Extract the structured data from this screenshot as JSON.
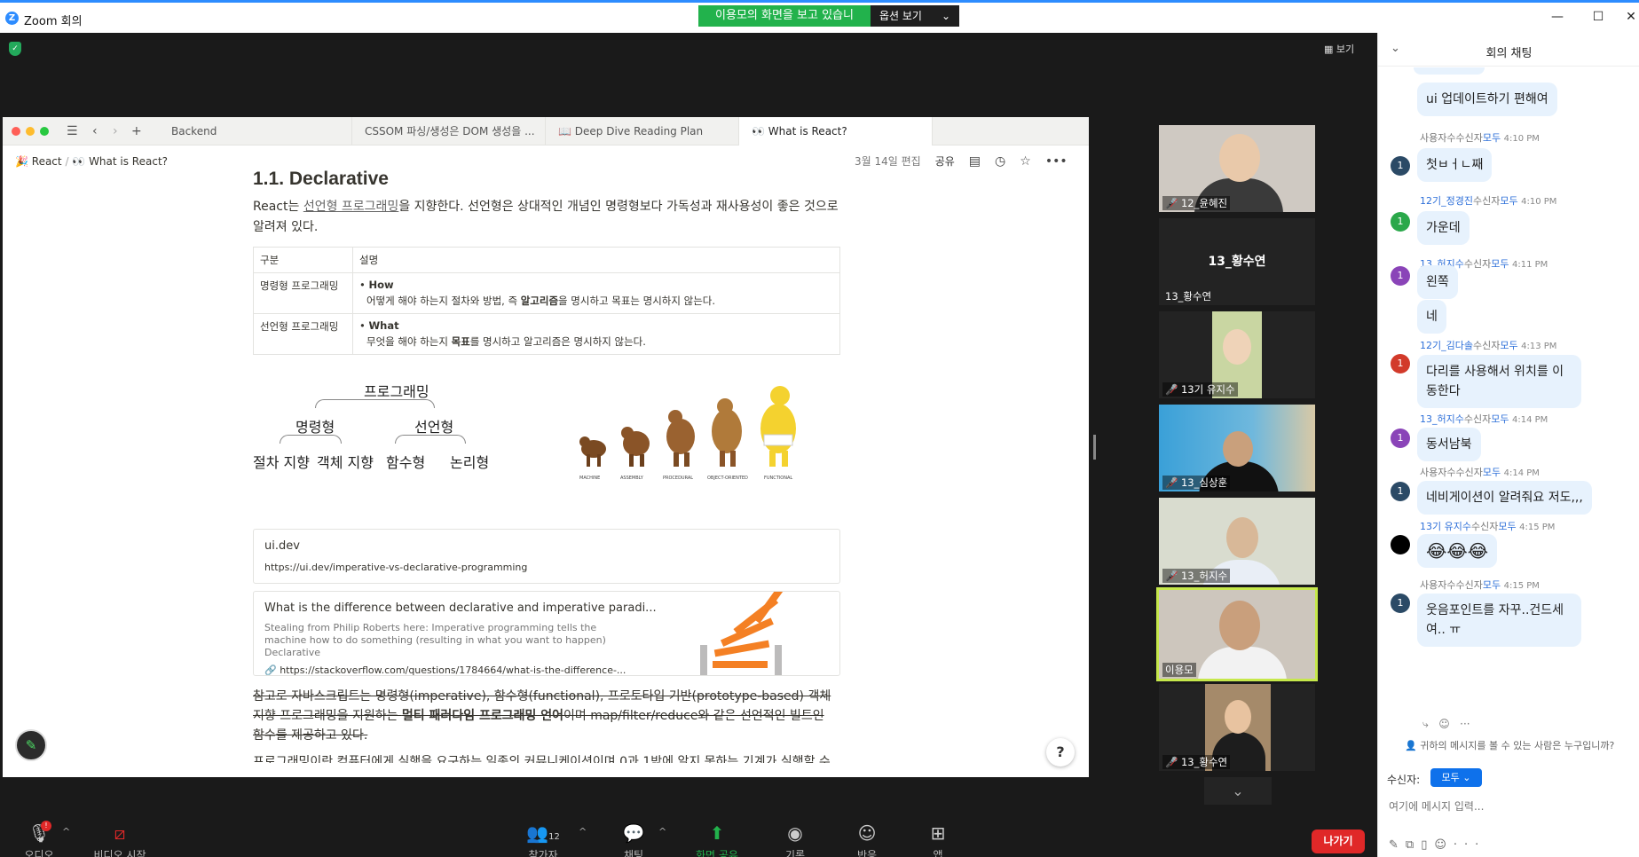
{
  "window": {
    "title": "Zoom 회의",
    "min": "—",
    "max": "☐",
    "close": "✕",
    "logo": "Z"
  },
  "share_banner": {
    "text": "이용모의 화면을 보고 있습니다",
    "options": "옵션 보기"
  },
  "view_label": "보기",
  "notion": {
    "tabs": [
      "Backend",
      "CSSOM 파싱/생성은 DOM 생성을 ...",
      "Deep Dive Reading Plan",
      "What is React?"
    ],
    "breadcrumb": {
      "parent": "React",
      "current": "What is React?"
    },
    "edited": "3월 14일 편집",
    "share": "공유",
    "heading": "1.1. Declarative",
    "intro_pre": "React는 ",
    "intro_link": "선언형 프로그래밍",
    "intro_post": "을 지향한다. 선언형은 상대적인 개념인 명령형보다 가독성과 재사용성이 좋은 것으로 알려져 있다.",
    "table": {
      "headers": [
        "구분",
        "설명"
      ],
      "rows": [
        {
          "label": "명령형 프로그래밍",
          "bullet": "How",
          "desc_pre": "어떻게 해야 하는지 절차와 방법, 즉 ",
          "desc_bold": "알고리즘",
          "desc_post": "을 명시하고 목표는 명시하지 않는다."
        },
        {
          "label": "선언형 프로그래밍",
          "bullet": "What",
          "desc_pre": "무엇을 해야 하는지 ",
          "desc_bold": "목표",
          "desc_post": "를 명시하고 알고리즘은 명시하지 않는다."
        }
      ]
    },
    "diagram": {
      "root": "프로그래밍",
      "left": "명령형",
      "right": "선언형",
      "leaves": [
        "절차 지향",
        "객체 지향",
        "함수형",
        "논리형"
      ],
      "evolution": [
        "MACHINE",
        "ASSEMBLY",
        "PROCEDURAL",
        "OBJECT-ORIENTED",
        "FUNCTIONAL"
      ]
    },
    "bookmark1": {
      "title": "ui.dev",
      "url": "https://ui.dev/imperative-vs-declarative-programming"
    },
    "bookmark2": {
      "title": "What is the difference between declarative and imperative paradi...",
      "desc": "Stealing from Philip Roberts here: Imperative programming tells the machine how to do something (resulting in what you want to happen) Declarative",
      "url": "https://stackoverflow.com/questions/1784664/what-is-the-difference-..."
    },
    "strike_1": "참고로 자바스크립트는 명령형(imperative), 함수형(functional), 프로토타입 기반(prototype-based) 객체지향 프로그래밍을 지원하는 ",
    "strike_bold": "멀티 패러다임 프로그래밍 언어",
    "strike_2": "이며 map/filter/reduce와 같은 선언적인 빌트인 함수를 제공하고 있다.",
    "cutoff": "프로그래밍이란 컴퓨터에게 실행을 요구하는 일종의 커뮤니케이션이며 0과 1밖에 알지 못하는 기계가 실행할 수",
    "help": "?"
  },
  "participants": [
    {
      "name": "12_윤혜진",
      "muted": true
    },
    {
      "name": "13_황수연",
      "muted": false,
      "big": "13_황수연"
    },
    {
      "name": "13기 유지수",
      "muted": true
    },
    {
      "name": "13_심상훈",
      "muted": true
    },
    {
      "name": "13_허지수",
      "muted": true
    },
    {
      "name": "이용모",
      "muted": false,
      "active": true
    },
    {
      "name": "13_황수연",
      "muted": true
    }
  ],
  "toolbar": {
    "audio": "오디오",
    "video": "비디오 시작",
    "participants": "참가자",
    "participants_count": "12",
    "chat": "채팅",
    "share": "화면 공유",
    "record": "기록",
    "reactions": "반응",
    "apps": "앱",
    "leave": "나가기",
    "audio_badge": "!"
  },
  "chat": {
    "title": "회의 채팅",
    "messages": [
      {
        "sender": "",
        "text": "ui 업데이트하기 편해여",
        "avatar": "",
        "color": ""
      },
      {
        "sender": "사용자수",
        "to": "모두",
        "time": "4:10 PM",
        "text": "첫ㅂㅓㄴ째",
        "avatar": "1",
        "color": "#2b4a66"
      },
      {
        "sender": "12기_정경진",
        "to": "모두",
        "time": "4:10 PM",
        "text": "가운데",
        "avatar": "1",
        "color": "#2aa84a"
      },
      {
        "sender": "13_허지수",
        "to": "모두",
        "time": "4:11 PM",
        "text": "왼쪽",
        "avatar": "1",
        "color": "#8a44b8"
      },
      {
        "sender": "",
        "text": "네",
        "avatar": "",
        "color": ""
      },
      {
        "sender": "12기_김다솔",
        "to": "모두",
        "time": "4:13 PM",
        "text": "다리를 사용해서 위치를 이동한다",
        "avatar": "1",
        "color": "#d23a2a"
      },
      {
        "sender": "13_허지수",
        "to": "모두",
        "time": "4:14 PM",
        "text": "동서남북",
        "avatar": "1",
        "color": "#8a44b8"
      },
      {
        "sender": "사용자수",
        "to": "모두",
        "time": "4:14 PM",
        "text": "네비게이션이 알려줘요 저도,,,",
        "avatar": "1",
        "color": "#2b4a66"
      },
      {
        "sender": "13기 유지수",
        "to": "모두",
        "time": "4:15 PM",
        "text": "😂😂😂",
        "avatar": "",
        "color": "#000000"
      },
      {
        "sender": "사용자수",
        "to": "모두",
        "time": "4:15 PM",
        "text": "웃음포인트를 자꾸..건드세여.. ㅠ",
        "avatar": "1",
        "color": "#2b4a66"
      }
    ],
    "recv_word": "수신자",
    "who_can": "귀하의 메시지를 볼 수 있는 사람은 누구입니까?",
    "to_label": "수신자:",
    "to_value": "모두",
    "input_placeholder": "여기에 메시지 입력..."
  }
}
